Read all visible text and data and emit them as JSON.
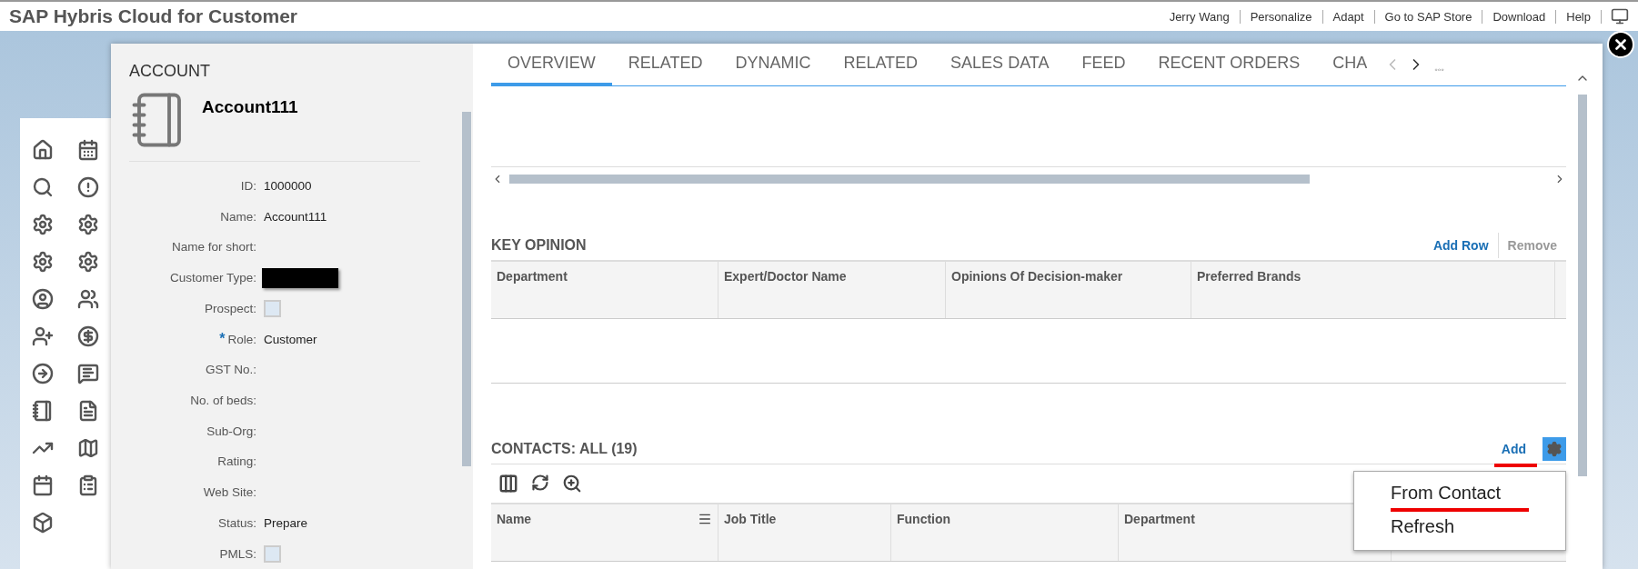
{
  "app_title": "SAP Hybris Cloud for Customer",
  "header_links": [
    "Jerry Wang",
    "Personalize",
    "Adapt",
    "Go to SAP Store",
    "Download",
    "Help"
  ],
  "account": {
    "section": "ACCOUNT",
    "required_mark": "*",
    "name": "Account111",
    "fields": [
      {
        "label": "ID:",
        "kind": "text",
        "value": "1000000",
        "required": false
      },
      {
        "label": "Name:",
        "kind": "text",
        "value": "Account111",
        "required": false
      },
      {
        "label": "Name for short:",
        "kind": "text",
        "required": false
      },
      {
        "label": "Customer Type:",
        "kind": "redacted",
        "required": false
      },
      {
        "label": "Prospect:",
        "kind": "checkbox",
        "checked": false,
        "required": false
      },
      {
        "label": "Role:",
        "kind": "text",
        "value": "Customer",
        "required": true
      },
      {
        "label": "GST No.:",
        "kind": "text",
        "required": false
      },
      {
        "label": "No. of beds:",
        "kind": "text",
        "required": false
      },
      {
        "label": "Sub-Org:",
        "kind": "text",
        "required": false
      },
      {
        "label": "Rating:",
        "kind": "text",
        "required": false
      },
      {
        "label": "Web Site:",
        "kind": "text",
        "required": false
      },
      {
        "label": "Status:",
        "kind": "text",
        "value": "Prepare",
        "required": false
      },
      {
        "label": "PMLS:",
        "kind": "checkbox",
        "checked": false,
        "required": false
      }
    ]
  },
  "tabs": [
    {
      "label": "OVERVIEW",
      "selected": true
    },
    {
      "label": "RELATED",
      "selected": false
    },
    {
      "label": "DYNAMIC",
      "selected": false
    },
    {
      "label": "RELATED",
      "selected": false
    },
    {
      "label": "SALES DATA",
      "selected": false
    },
    {
      "label": "FEED",
      "selected": false
    },
    {
      "label": "RECENT ORDERS",
      "selected": false
    },
    {
      "label": "CHA",
      "selected": false
    }
  ],
  "tab_more": "◦◦◦",
  "key_opinion": {
    "title": "KEY OPINION",
    "actions": [
      {
        "label": "Add Row",
        "disabled": false
      },
      {
        "label": "Remove",
        "disabled": true
      }
    ],
    "columns": [
      "Department",
      "Expert/Doctor Name",
      "Opinions Of Decision-maker",
      "Preferred Brands"
    ]
  },
  "contacts": {
    "title": "CONTACTS: ALL (19)",
    "add": "Add",
    "columns": [
      "Name",
      "Job Title",
      "Function",
      "Department"
    ],
    "menu": [
      "From Contact",
      "Refresh"
    ]
  }
}
